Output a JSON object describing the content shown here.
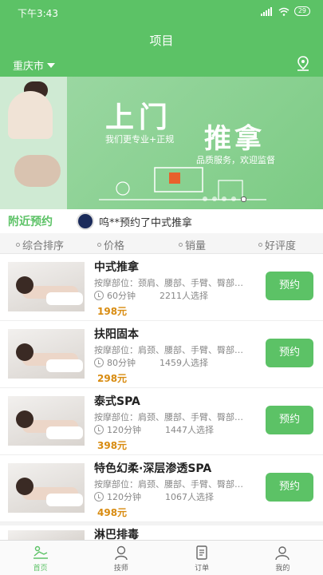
{
  "status": {
    "time": "下午3:43",
    "battery": "29"
  },
  "header": {
    "title": "项目",
    "city": "重庆市"
  },
  "banner": {
    "headline1": "上门",
    "headline2": "推拿",
    "slogan1": "我们更专业+正规",
    "slogan2": "品质服务，欢迎监督",
    "dot_count": 5,
    "active_dot": 4
  },
  "nearby": {
    "title": "附近预约",
    "text": "呜**预约了中式推拿"
  },
  "sort": {
    "items": [
      "综合排序",
      "价格",
      "销量",
      "好评度"
    ],
    "active_index": 0
  },
  "items": [
    {
      "name": "中式推拿",
      "parts": "按摩部位：颈肩、腰部、手臂、臀部…",
      "duration": "60分钟",
      "count": "2211人选择",
      "price": "198元",
      "button": "预约"
    },
    {
      "name": "扶阳固本",
      "parts": "按摩部位：肩颈、腰部、手臂、臀部…",
      "duration": "80分钟",
      "count": "1459人选择",
      "price": "298元",
      "button": "预约"
    },
    {
      "name": "泰式SPA",
      "parts": "按摩部位：肩颈、腰部、手臂、臀部…",
      "duration": "120分钟",
      "count": "1447人选择",
      "price": "398元",
      "button": "预约"
    },
    {
      "name": "特色幻柔·深层渗透SPA",
      "parts": "按摩部位：肩颈、腰部、手臂、臀部…",
      "duration": "120分钟",
      "count": "1067人选择",
      "price": "498元",
      "button": "预约"
    }
  ],
  "partial_item": {
    "name": "淋巴排毒"
  },
  "tabbar": {
    "items": [
      "首页",
      "技师",
      "订单",
      "我的"
    ],
    "active_index": 0
  },
  "colors": {
    "brand": "#5cc266",
    "price": "#d88b10"
  }
}
